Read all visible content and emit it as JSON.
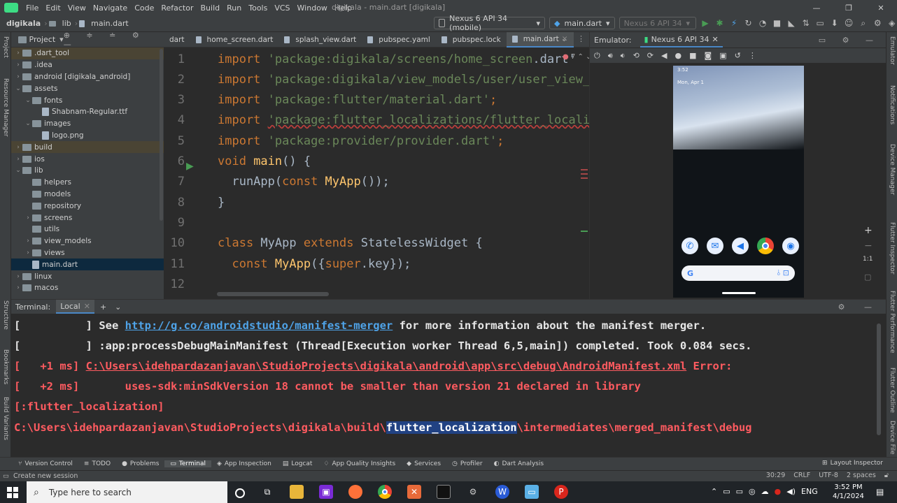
{
  "menu": [
    "File",
    "Edit",
    "View",
    "Navigate",
    "Code",
    "Refactor",
    "Build",
    "Run",
    "Tools",
    "VCS",
    "Window",
    "Help"
  ],
  "window_title": "digikala - main.dart [digikala]",
  "nav": {
    "crumbs": [
      "digikala",
      "lib",
      "main.dart"
    ],
    "device_combo": "Nexus 6 API 34 (mobile)",
    "config_combo": "main.dart",
    "device_combo2": "Nexus 6 API 34"
  },
  "left_strip": [
    "Project",
    "Resource Manager",
    "Structure",
    "Bookmarks",
    "Build Variants"
  ],
  "right_strip": [
    "Emulator",
    "Notifications",
    "Device Manager",
    "Flutter Inspector",
    "Flutter Performance",
    "Flutter Outline",
    "Device File"
  ],
  "project": {
    "title": "Project",
    "items": [
      {
        "label": ".dart_tool",
        "indent": 1,
        "arrow": "›",
        "type": "folder",
        "hl": true
      },
      {
        "label": ".idea",
        "indent": 1,
        "arrow": "›",
        "type": "folder"
      },
      {
        "label": "android [digikala_android]",
        "indent": 1,
        "arrow": "›",
        "type": "folder"
      },
      {
        "label": "assets",
        "indent": 1,
        "arrow": "⌄",
        "type": "folder"
      },
      {
        "label": "fonts",
        "indent": 2,
        "arrow": "⌄",
        "type": "folder"
      },
      {
        "label": "Shabnam-Regular.ttf",
        "indent": 3,
        "arrow": "",
        "type": "file"
      },
      {
        "label": "images",
        "indent": 2,
        "arrow": "⌄",
        "type": "folder"
      },
      {
        "label": "logo.png",
        "indent": 3,
        "arrow": "",
        "type": "file"
      },
      {
        "label": "build",
        "indent": 1,
        "arrow": "›",
        "type": "folder",
        "hl": true
      },
      {
        "label": "ios",
        "indent": 1,
        "arrow": "›",
        "type": "folder"
      },
      {
        "label": "lib",
        "indent": 1,
        "arrow": "⌄",
        "type": "folder"
      },
      {
        "label": "helpers",
        "indent": 2,
        "arrow": "",
        "type": "folder"
      },
      {
        "label": "models",
        "indent": 2,
        "arrow": "",
        "type": "folder"
      },
      {
        "label": "repository",
        "indent": 2,
        "arrow": "",
        "type": "folder"
      },
      {
        "label": "screens",
        "indent": 2,
        "arrow": "›",
        "type": "folder"
      },
      {
        "label": "utils",
        "indent": 2,
        "arrow": "",
        "type": "folder"
      },
      {
        "label": "view_models",
        "indent": 2,
        "arrow": "›",
        "type": "folder"
      },
      {
        "label": "views",
        "indent": 2,
        "arrow": "›",
        "type": "folder"
      },
      {
        "label": "main.dart",
        "indent": 2,
        "arrow": "",
        "type": "file",
        "sel": true
      },
      {
        "label": "linux",
        "indent": 1,
        "arrow": "›",
        "type": "folder"
      },
      {
        "label": "macos",
        "indent": 1,
        "arrow": "›",
        "type": "folder"
      }
    ]
  },
  "tabs": [
    {
      "label": "dart",
      "active": false
    },
    {
      "label": "home_screen.dart",
      "active": false
    },
    {
      "label": "splash_view.dart",
      "active": false
    },
    {
      "label": "pubspec.yaml",
      "active": false
    },
    {
      "label": "pubspec.lock",
      "active": false
    },
    {
      "label": "main.dart",
      "active": true
    }
  ],
  "code_lines": [
    {
      "n": "1",
      "html": [
        [
          "kw",
          "import "
        ],
        [
          "str",
          "'package:digikala/screens/home_screen"
        ],
        [
          "pl",
          ".dart'"
        ]
      ]
    },
    {
      "n": "2",
      "html": [
        [
          "kw",
          "import "
        ],
        [
          "str",
          "'package:digikala/view_models/user/user_view_model.dart'"
        ]
      ]
    },
    {
      "n": "3",
      "html": [
        [
          "kw",
          "import "
        ],
        [
          "str",
          "'package:flutter/material.dart'"
        ],
        [
          "kw",
          ";"
        ]
      ]
    },
    {
      "n": "4",
      "html": [
        [
          "kw",
          "import "
        ],
        [
          "str",
          "'package:flutter_localizations/flutter_localizations.dart'"
        ]
      ]
    },
    {
      "n": "5",
      "html": [
        [
          "kw",
          "import "
        ],
        [
          "str",
          "'package:provider/provider.dart'"
        ],
        [
          "kw",
          ";"
        ]
      ]
    },
    {
      "n": "6",
      "html": [
        [
          "kw",
          "void "
        ],
        [
          "fn",
          "main"
        ],
        [
          "pl",
          "() {"
        ]
      ]
    },
    {
      "n": "7",
      "html": [
        [
          "pl",
          "  runApp("
        ],
        [
          "kw",
          "const "
        ],
        [
          "fn",
          "MyApp"
        ],
        [
          "pl",
          "());"
        ]
      ]
    },
    {
      "n": "8",
      "html": [
        [
          "pl",
          "}"
        ]
      ]
    },
    {
      "n": "9",
      "html": []
    },
    {
      "n": "10",
      "html": [
        [
          "kw",
          "class "
        ],
        [
          "cls",
          "MyApp "
        ],
        [
          "kw",
          "extends "
        ],
        [
          "cls",
          "StatelessWidget {"
        ]
      ]
    },
    {
      "n": "11",
      "html": [
        [
          "pl",
          "  "
        ],
        [
          "kw",
          "const "
        ],
        [
          "fn",
          "MyApp"
        ],
        [
          "pl",
          "({"
        ],
        [
          "kw",
          "super"
        ],
        [
          "pl",
          ".key});"
        ]
      ]
    },
    {
      "n": "12",
      "html": []
    }
  ],
  "emulator": {
    "label": "Emulator:",
    "device": "Nexus 6 API 34",
    "phone_time": "3:52",
    "phone_date": "Mon, Apr 1",
    "zoom": "1:1"
  },
  "terminal": {
    "title": "Terminal:",
    "tab": "Local",
    "lines": [
      [
        [
          "w",
          "[          ] See "
        ],
        [
          "lnk",
          "http://g.co/androidstudio/manifest-merger"
        ],
        [
          "w",
          " for more information about the manifest merger."
        ]
      ],
      [
        [
          "w",
          "[          ] :app:processDebugMainManifest (Thread[Execution worker Thread 6,5,main]) completed. Took 0.084 secs."
        ]
      ],
      [
        [
          "r",
          "[   +1 ms] "
        ],
        [
          "redlink",
          "C:\\Users\\idehpardazanjavan\\StudioProjects\\digikala\\android\\app\\src\\debug\\AndroidManifest.xml"
        ],
        [
          "r",
          " Error:"
        ]
      ],
      [
        [
          "r",
          "[   +2 ms]       uses-sdk:minSdkVersion 18 cannot be smaller than version 21 declared in library"
        ]
      ],
      [
        [
          "r",
          "[:flutter_localization]"
        ]
      ],
      [
        [
          "r",
          "C:\\Users\\idehpardazanjavan\\StudioProjects\\digikala\\build\\"
        ],
        [
          "hlsel",
          "flutter_localization"
        ],
        [
          "r",
          "\\intermediates\\merged_manifest\\debug"
        ]
      ]
    ]
  },
  "bottom_tools": [
    "Version Control",
    "TODO",
    "Problems",
    "Terminal",
    "App Inspection",
    "Logcat",
    "App Quality Insights",
    "Services",
    "Profiler",
    "Dart Analysis"
  ],
  "layout_inspector": "Layout Inspector",
  "status": {
    "left": "Create new session",
    "pos": "30:29",
    "eol": "CRLF",
    "enc": "UTF-8",
    "indent": "2 spaces"
  },
  "taskbar": {
    "search": "Type here to search",
    "lang": "ENG",
    "time": "3:52 PM",
    "date": "4/1/2024"
  },
  "colors": {
    "accent": "#4a88c7",
    "error": "#ff5b60",
    "link": "#4fa3e8",
    "run": "#499c54"
  }
}
